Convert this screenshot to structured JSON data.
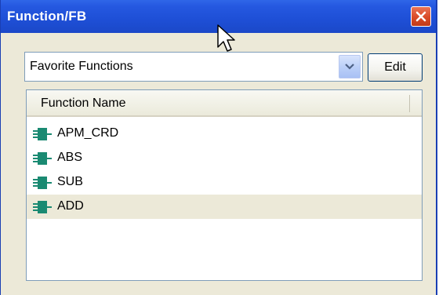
{
  "window": {
    "title": "Function/FB"
  },
  "toolbar": {
    "combo_value": "Favorite Functions",
    "edit_label": "Edit"
  },
  "list": {
    "header": "Function Name",
    "items": [
      {
        "label": "APM_CRD",
        "icon": "function-block-icon",
        "selected": false
      },
      {
        "label": "ABS",
        "icon": "function-block-icon",
        "selected": false
      },
      {
        "label": "SUB",
        "icon": "function-block-icon",
        "selected": false
      },
      {
        "label": "ADD",
        "icon": "function-block-icon",
        "selected": true
      }
    ]
  },
  "colors": {
    "titlebar": "#1e4fd6",
    "window_bg": "#ece9d8",
    "close": "#d94b27",
    "icon": "#1a8a72",
    "selection": "#ece9d8"
  }
}
